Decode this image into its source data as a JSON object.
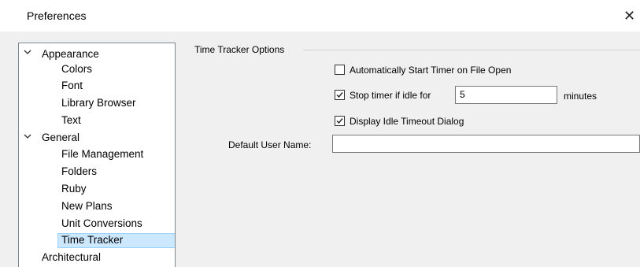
{
  "window": {
    "title": "Preferences",
    "close_glyph": "✕"
  },
  "tree": {
    "items": [
      {
        "label": "Appearance",
        "level": 0,
        "expanded": true
      },
      {
        "label": "Colors",
        "level": 1
      },
      {
        "label": "Font",
        "level": 1
      },
      {
        "label": "Library Browser",
        "level": 1
      },
      {
        "label": "Text",
        "level": 1
      },
      {
        "label": "General",
        "level": 0,
        "expanded": true
      },
      {
        "label": "File Management",
        "level": 1
      },
      {
        "label": "Folders",
        "level": 1
      },
      {
        "label": "Ruby",
        "level": 1
      },
      {
        "label": "New Plans",
        "level": 1
      },
      {
        "label": "Unit Conversions",
        "level": 1
      },
      {
        "label": "Time Tracker",
        "level": 1,
        "selected": true
      },
      {
        "label": "Architectural",
        "level": 0
      }
    ],
    "chevron_glyph": "❯"
  },
  "options": {
    "group_title": "Time Tracker Options",
    "auto_start": {
      "label": "Automatically Start Timer on File Open",
      "checked": false
    },
    "stop_idle": {
      "label": "Stop timer if idle for",
      "checked": true,
      "value": "5",
      "unit": "minutes"
    },
    "idle_dialog": {
      "label": "Display Idle Timeout Dialog",
      "checked": true
    },
    "default_user": {
      "label": "Default User Name:",
      "value": ""
    }
  },
  "colors": {
    "selection_bg": "#cce8ff",
    "selection_border": "#99d1ff"
  }
}
